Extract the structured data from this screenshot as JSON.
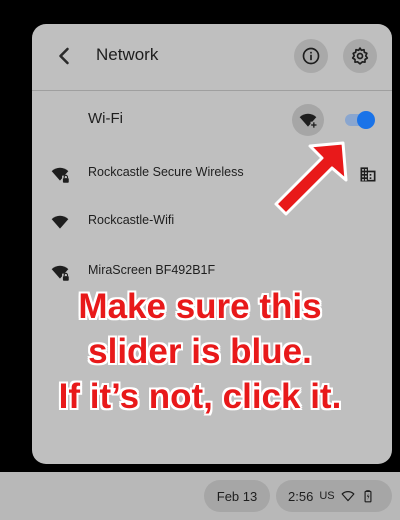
{
  "header": {
    "title": "Network"
  },
  "wifi": {
    "label": "Wi-Fi",
    "enabled": true
  },
  "networks": [
    {
      "name": "Rockcastle Secure Wireless",
      "secured": true,
      "enterprise": true
    },
    {
      "name": "Rockcastle-Wifi",
      "secured": false,
      "enterprise": false
    },
    {
      "name": "MiraScreen BF492B1F",
      "secured": true,
      "enterprise": false
    }
  ],
  "overlay": {
    "line1": "Make sure this",
    "line2": "slider is blue.",
    "line3": "If it’s not, click it."
  },
  "shelf": {
    "date": "Feb 13",
    "time": "2:56",
    "locale": "US"
  },
  "colors": {
    "toggle_on": "#1a73e8",
    "annotation": "#e8191a"
  }
}
